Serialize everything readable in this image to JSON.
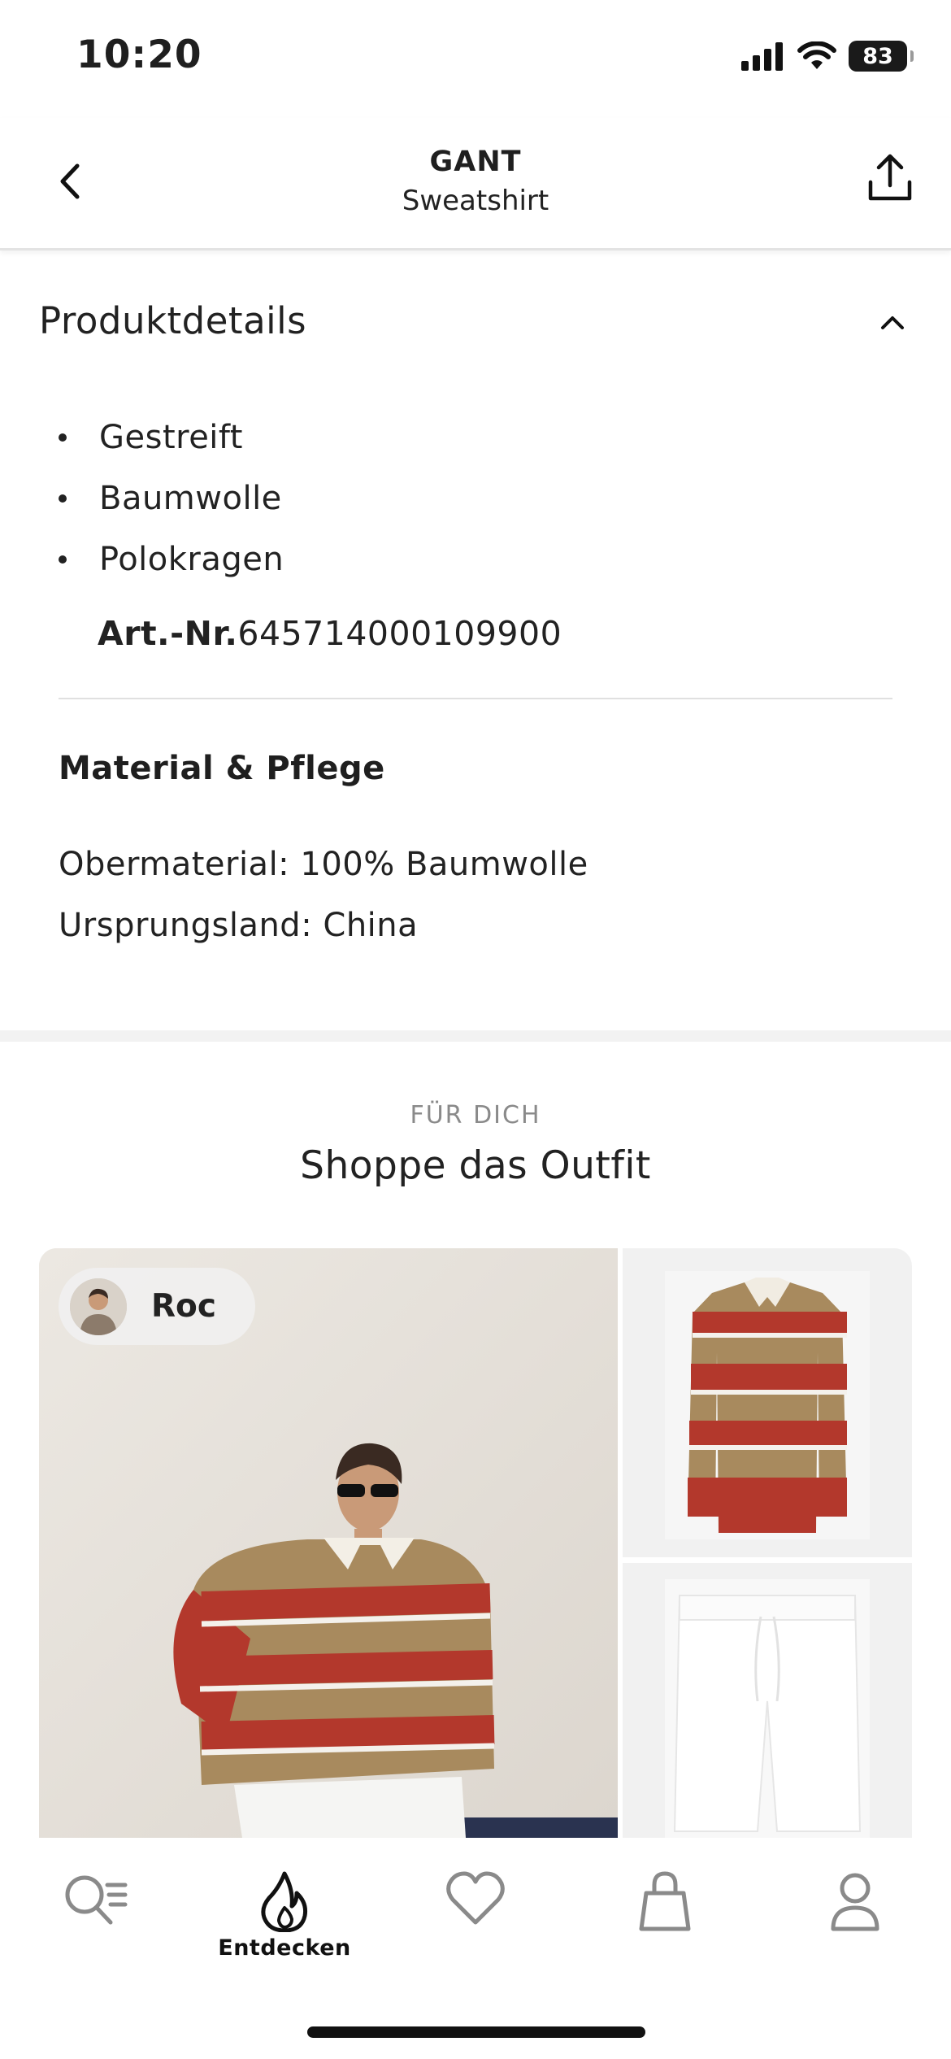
{
  "status_bar": {
    "time": "10:20",
    "battery": "83"
  },
  "header": {
    "brand": "GANT",
    "product": "Sweatshirt"
  },
  "details": {
    "title": "Produktdetails",
    "bullets": [
      "Gestreift",
      "Baumwolle",
      "Polokragen"
    ],
    "article_label": "Art.-Nr.",
    "article_number": "645714000109900"
  },
  "material": {
    "title": "Material & Pflege",
    "lines": [
      "Obermaterial: 100% Baumwolle",
      "Ursprungsland: China"
    ]
  },
  "outfit": {
    "eyebrow": "FÜR DICH",
    "title": "Shoppe das Outfit",
    "creator": "Roc"
  },
  "tab_bar": {
    "items": [
      {
        "icon": "search-list-icon",
        "label": ""
      },
      {
        "icon": "flame-icon",
        "label": "Entdecken"
      },
      {
        "icon": "heart-icon",
        "label": ""
      },
      {
        "icon": "shopping-bag-icon",
        "label": ""
      },
      {
        "icon": "profile-icon",
        "label": ""
      }
    ]
  },
  "colors": {
    "stripe_red": "#b3382c",
    "stripe_tan": "#a88a5e",
    "divider": "#e0e0e0",
    "accent_text": "#8a8a8a"
  }
}
